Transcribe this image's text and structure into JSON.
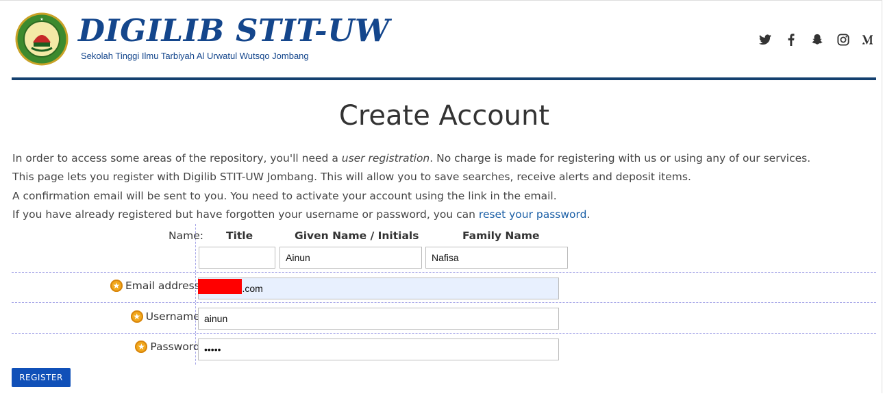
{
  "header": {
    "title": "DIGILIB STIT-UW",
    "subtitle": "Sekolah Tinggi Ilmu Tarbiyah Al Urwatul Wutsqo Jombang",
    "seal_text": "STIT-UW JOMBANG",
    "social_icons": [
      "twitter-icon",
      "facebook-icon",
      "snapchat-icon",
      "instagram-icon",
      "medium-icon"
    ]
  },
  "page": {
    "title": "Create Account",
    "intro": {
      "line1_a": "In order to access some areas of the repository, you'll need a ",
      "line1_em": "user registration",
      "line1_b": ". No charge is made for registering with us or using any of our services.",
      "line2": "This page lets you register with Digilib STIT-UW Jombang. This will allow you to save searches, receive alerts and deposit items.",
      "line3": "A confirmation email will be sent to you. You need to activate your account using the link in the email.",
      "line4_a": "If you have already registered but have forgotten your username or password, you can ",
      "line4_link": "reset your password",
      "line4_b": "."
    }
  },
  "form": {
    "name_label": "Name:",
    "col_title": "Title",
    "col_given": "Given Name / Initials",
    "col_family": "Family Name",
    "title_value": "",
    "given_value": "Ainun",
    "family_value": "Nafisa",
    "email_label": "Email address:",
    "email_value": "a@gmail.com",
    "username_label": "Username:",
    "username_value": "ainun",
    "password_label": "Password:",
    "password_value": "•••••",
    "register_label": "REGISTER"
  },
  "colors": {
    "brand": "#14468c",
    "rule": "#14406f",
    "button": "#1050b8",
    "link": "#1b5fa6",
    "required_star": "#f2a81c",
    "autofill_bg": "#e8f0fe"
  }
}
